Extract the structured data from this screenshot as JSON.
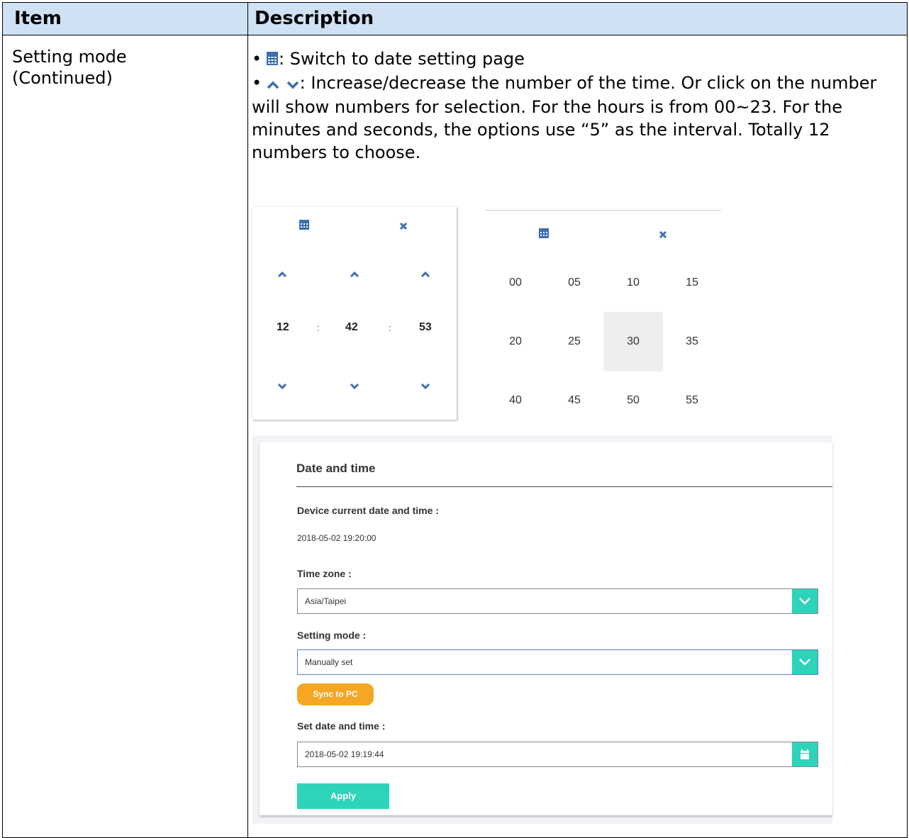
{
  "table": {
    "headers": {
      "item": "Item",
      "description": "Description"
    },
    "item_text_line1": "Setting mode",
    "item_text_line2": "(Continued)"
  },
  "description": {
    "bullet": "•",
    "line1": ": Switch to date setting page",
    "line2": ": Increase/decrease the number of the time. Or click on the number will show numbers for selection. For the hours is from 00~23. For the minutes and seconds, the options use “5” as the interval. Totally 12 numbers to choose."
  },
  "time_picker": {
    "hour": "12",
    "minute": "42",
    "second": "53",
    "separator": ":"
  },
  "minute_grid": {
    "values": [
      "00",
      "05",
      "10",
      "15",
      "20",
      "25",
      "30",
      "35",
      "40",
      "45",
      "50",
      "55"
    ],
    "selected": "30"
  },
  "form": {
    "title": "Date and time",
    "current_label": "Device current date and time :",
    "current_value": "2018-05-02 19:20:00",
    "timezone_label": "Time zone :",
    "timezone_value": "Asia/Taipei",
    "mode_label": "Setting mode :",
    "mode_value": "Manually set",
    "sync_button": "Sync to PC",
    "set_label": "Set date and time :",
    "set_value": "2018-05-02 19:19:44",
    "apply_button": "Apply"
  },
  "colors": {
    "header_bg": "#cfe1f3",
    "icon_blue": "#3a6fb5",
    "accent_teal": "#2dd4b9",
    "accent_orange": "#f5a623"
  }
}
